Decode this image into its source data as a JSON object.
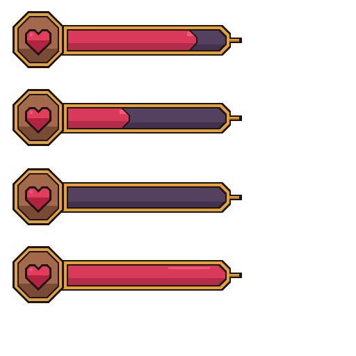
{
  "health_bars": [
    {
      "id": "bar-1",
      "fill_fraction": 0.82
    },
    {
      "id": "bar-2",
      "fill_fraction": 0.39
    },
    {
      "id": "bar-3",
      "fill_fraction": 0.0
    },
    {
      "id": "bar-4",
      "fill_fraction": 1.0
    }
  ],
  "colors": {
    "outline": "#1a1412",
    "gold": "#e3a13a",
    "gold_dark": "#b87a22",
    "medallion": "#a4684a",
    "medallion_dark": "#7a4a34",
    "heart": "#e23d5a",
    "heart_dark": "#b0243f",
    "fill": "#d93a5a",
    "fill_shade": "#b32c49",
    "fill_highlight": "#ee5a77",
    "empty": "#54405f",
    "empty_shade": "#43314e"
  },
  "icon": "heart-icon"
}
